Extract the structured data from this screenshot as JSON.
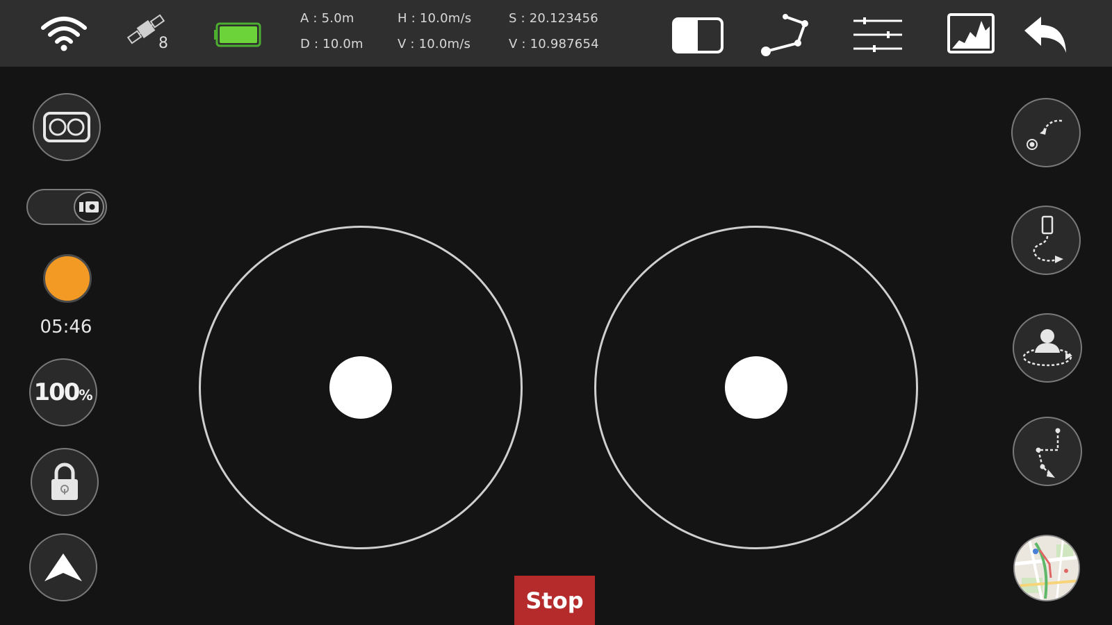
{
  "status": {
    "satellites": "8",
    "battery_color": "#6cd43a"
  },
  "telemetry": {
    "altitude": "A : 5.0m",
    "distance": "D : 10.0m",
    "h_speed": "H : 10.0m/s",
    "v_speed": "V : 10.0m/s",
    "lat": "S : 20.123456",
    "lon": "V : 10.987654"
  },
  "toolbar": {
    "icons": [
      "split-screen-icon",
      "waypoint-path-icon",
      "sliders-icon",
      "histogram-icon",
      "back-arrow-icon"
    ]
  },
  "left_panel": {
    "vr_icon": "vr-glasses-icon",
    "toggle_icon": "camera-icon",
    "record_color": "#f39a24",
    "record_time": "05:46",
    "speed_value": "100",
    "speed_unit": "%",
    "lock_icon": "lock-icon",
    "takeoff_icon": "arrow-up-icon"
  },
  "right_panel": {
    "icons": [
      "return-home-icon",
      "follow-phone-icon",
      "orbit-person-icon",
      "waypoints-icon",
      "map-icon"
    ]
  },
  "controls": {
    "stop_label": "Stop",
    "stop_color": "#b52b2b"
  }
}
